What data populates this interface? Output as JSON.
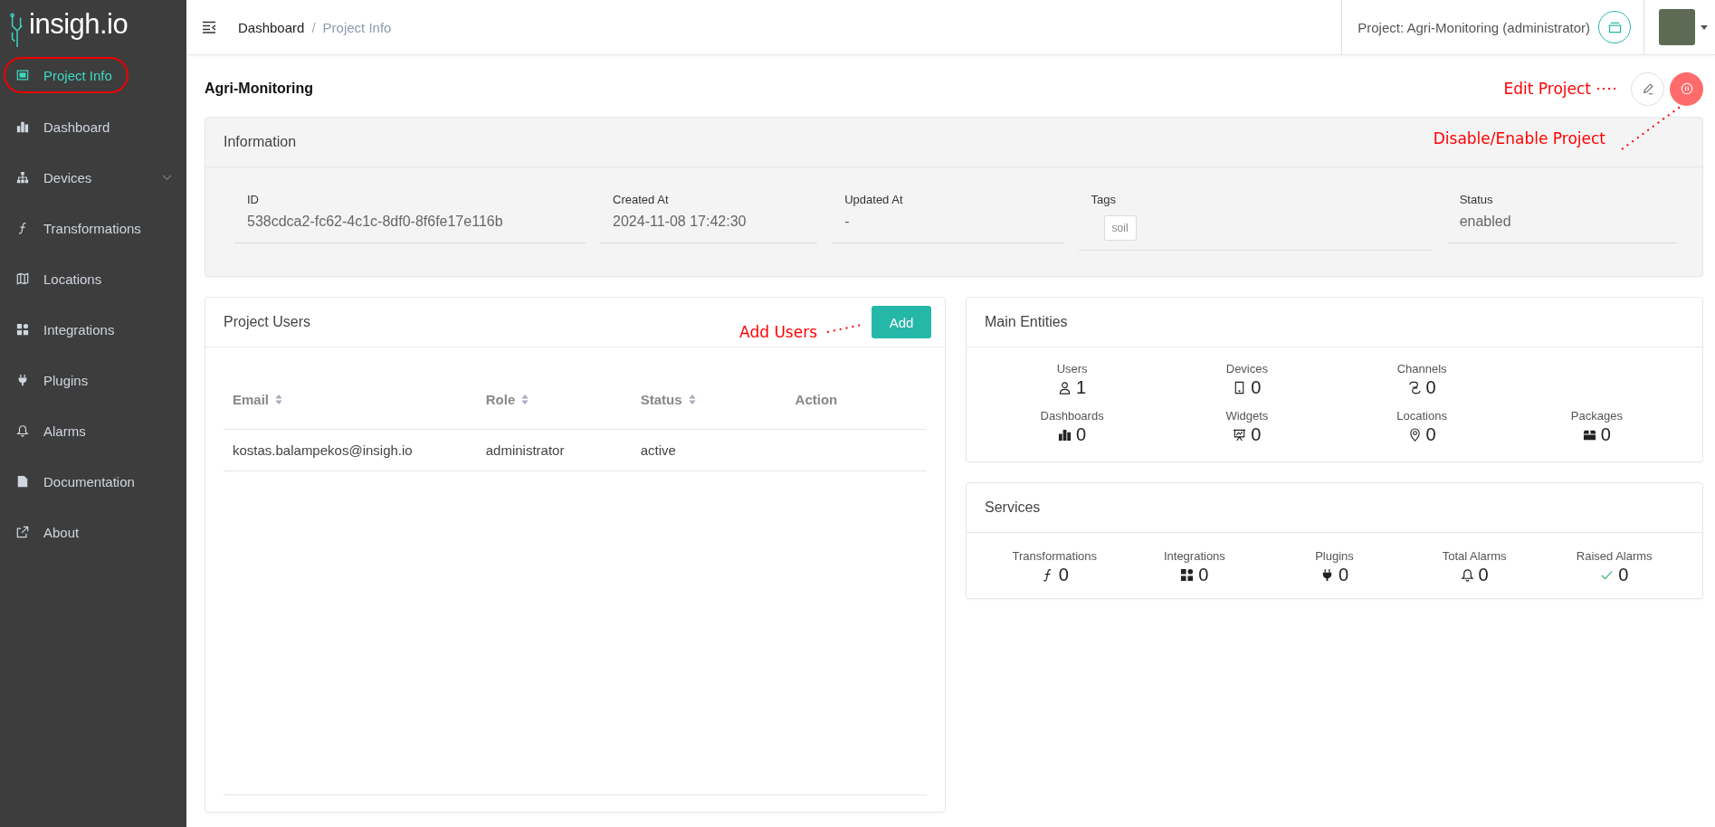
{
  "sidebar": {
    "logo": "insigh.io",
    "items": [
      {
        "label": "Project Info",
        "selected": true,
        "circled": true
      },
      {
        "label": "Dashboard",
        "selected": false,
        "circled": false
      },
      {
        "label": "Devices",
        "selected": false,
        "circled": false,
        "expanded": false
      },
      {
        "label": "Transformations",
        "selected": false,
        "circled": false
      },
      {
        "label": "Locations",
        "selected": false,
        "circled": false
      },
      {
        "label": "Integrations",
        "selected": false,
        "circled": false
      },
      {
        "label": "Plugins",
        "selected": false,
        "circled": false
      },
      {
        "label": "Alarms",
        "selected": false,
        "circled": false
      },
      {
        "label": "Documentation",
        "selected": false,
        "circled": false
      },
      {
        "label": "About",
        "selected": false,
        "circled": false
      }
    ]
  },
  "header": {
    "breadcrumb": [
      {
        "label": "Dashboard",
        "selected": false
      },
      {
        "label": "Project Info",
        "selected": true
      }
    ],
    "separator": "/",
    "project": "Project: Agri-Monitoring (administrator)"
  },
  "page": {
    "title": "Agri-Monitoring",
    "annotations": {
      "edit": "Edit Project",
      "toggle": "Disable/Enable Project"
    }
  },
  "information": {
    "title": "Information",
    "fields": [
      {
        "label": "ID",
        "kind": "text",
        "value": "538cdca2-fc62-4c1c-8df0-8f6fe17e116b"
      },
      {
        "label": "Created At",
        "kind": "text",
        "value": "2024-11-08 17:42:30"
      },
      {
        "label": "Updated At",
        "kind": "text",
        "value": "-"
      },
      {
        "label": "Tags",
        "kind": "tags",
        "tags": [
          "soil"
        ]
      },
      {
        "label": "Status",
        "kind": "text",
        "value": "enabled"
      }
    ]
  },
  "project_users": {
    "title": "Project Users",
    "annotation": "Add Users",
    "add_button": "Add",
    "columns": [
      {
        "label": "Email",
        "sortable": true
      },
      {
        "label": "Role",
        "sortable": true
      },
      {
        "label": "Status",
        "sortable": true
      },
      {
        "label": "Action",
        "sortable": false
      }
    ],
    "rows": [
      {
        "email": "kostas.balampekos@insigh.io",
        "role": "administrator",
        "status": "active"
      }
    ]
  },
  "main_entities": {
    "title": "Main Entities",
    "rows": [
      [
        {
          "label": "Users",
          "value": "1"
        },
        {
          "label": "Devices",
          "value": "0"
        },
        {
          "label": "Channels",
          "value": "0"
        }
      ],
      [
        {
          "label": "Dashboards",
          "value": "0"
        },
        {
          "label": "Widgets",
          "value": "0"
        },
        {
          "label": "Locations",
          "value": "0"
        },
        {
          "label": "Packages",
          "value": "0"
        }
      ]
    ]
  },
  "services": {
    "title": "Services",
    "items": [
      {
        "label": "Transformations",
        "value": "0"
      },
      {
        "label": "Integrations",
        "value": "0"
      },
      {
        "label": "Plugins",
        "value": "0"
      },
      {
        "label": "Total Alarms",
        "value": "0"
      },
      {
        "label": "Raised Alarms",
        "value": "0"
      }
    ]
  }
}
